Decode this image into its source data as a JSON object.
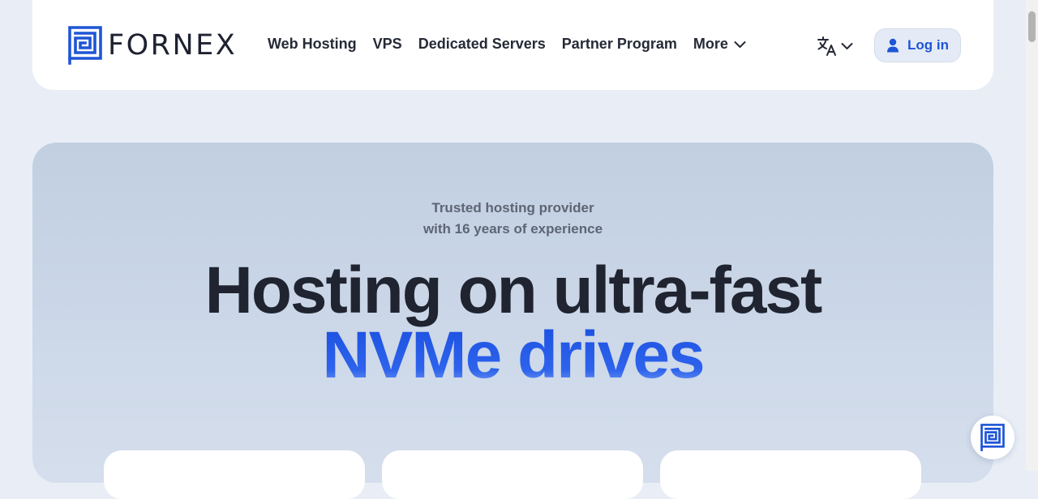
{
  "brand": {
    "name": "FORNEX",
    "logo_icon": "fornex-maze-logo",
    "color": "#1f55d6"
  },
  "nav": {
    "items": [
      {
        "label": "Web Hosting"
      },
      {
        "label": "VPS"
      },
      {
        "label": "Dedicated Servers"
      },
      {
        "label": "Partner Program"
      },
      {
        "label": "More",
        "icon": "chevron-down-icon"
      }
    ]
  },
  "language": {
    "icon": "translate-icon"
  },
  "login": {
    "label": "Log in",
    "icon": "user-icon"
  },
  "hero": {
    "tagline_line1": "Trusted hosting provider",
    "tagline_line2": "with 16 years of experience",
    "headline_line1": "Hosting on ultra-fast",
    "headline_line2": "NVMe drives",
    "accent_color": "#1f55d6"
  },
  "chat_widget": {
    "icon": "fornex-maze-logo"
  }
}
